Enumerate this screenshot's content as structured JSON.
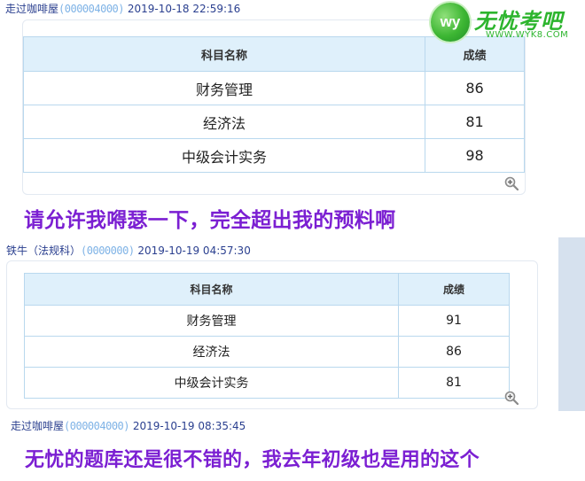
{
  "posts": [
    {
      "author": "走过咖啡屋",
      "masked_id": "(000004000)",
      "timestamp": "2019-10-18 22:59:16",
      "table": {
        "headers": [
          "科目名称",
          "成绩"
        ],
        "rows": [
          [
            "财务管理",
            "86"
          ],
          [
            "经济法",
            "81"
          ],
          [
            "中级会计实务",
            "98"
          ]
        ]
      },
      "comment": "请允许我嘚瑟一下，完全超出我的预料啊"
    },
    {
      "author": "铁牛（法规科）",
      "masked_id": "(0000000)",
      "timestamp": "2019-10-19 04:57:30",
      "table": {
        "headers": [
          "科目名称",
          "成绩"
        ],
        "rows": [
          [
            "财务管理",
            "91"
          ],
          [
            "经济法",
            "86"
          ],
          [
            "中级会计实务",
            "81"
          ]
        ]
      }
    },
    {
      "author": "走过咖啡屋",
      "masked_id": "(000004000)",
      "timestamp": "2019-10-19 08:35:45",
      "comment": "无忧的题库还是很不错的，我去年初级也是用的这个"
    }
  ],
  "watermark": {
    "badge": "wy",
    "name": "无忧考吧",
    "url": "WWW.WYK8.COM"
  },
  "icons": {
    "zoom": "zoom-in-icon"
  }
}
